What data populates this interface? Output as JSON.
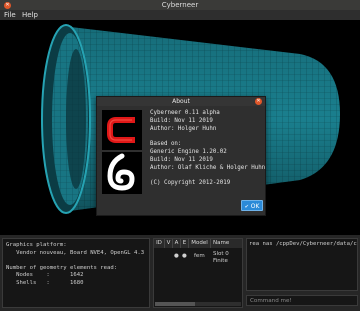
{
  "window": {
    "title": "Cyberneer"
  },
  "menu": {
    "file": "File",
    "help": "Help"
  },
  "about": {
    "title": "About",
    "lines": [
      "Cyberneer 0.11 alpha",
      "Build: Nov 11 2019",
      "Author: Holger Huhn",
      "",
      "Based on:",
      "Generic Engine 1.20.02",
      "Build: Nov 11 2019",
      "Author: Olaf Kliche & Holger Huhn",
      "",
      "(C) Copyright 2012-2019"
    ],
    "ok_label": "OK"
  },
  "info_panel": {
    "lines": [
      "Graphics platform:",
      "   Vendor nouveau, Board NVE4, OpenGL 4.3",
      "",
      "Number of geometry elements read:",
      "   Nodes    :      1642",
      "   Shells   :      1680"
    ]
  },
  "table": {
    "columns": [
      "ID",
      "V",
      "A",
      "E",
      "Model",
      "Name"
    ],
    "row": {
      "id": "",
      "v": "",
      "a": "●",
      "e": "●",
      "model": "fem",
      "name": "Slot 0 Finite"
    }
  },
  "console": {
    "lines": [
      "rea nas /cppDev/Cyberneer/data/c"
    ]
  },
  "command": {
    "placeholder": "Command me!"
  },
  "colors": {
    "cylinder": "#1b8a99",
    "logo_red": "#e01818",
    "ok_button": "#2b8ad8"
  }
}
